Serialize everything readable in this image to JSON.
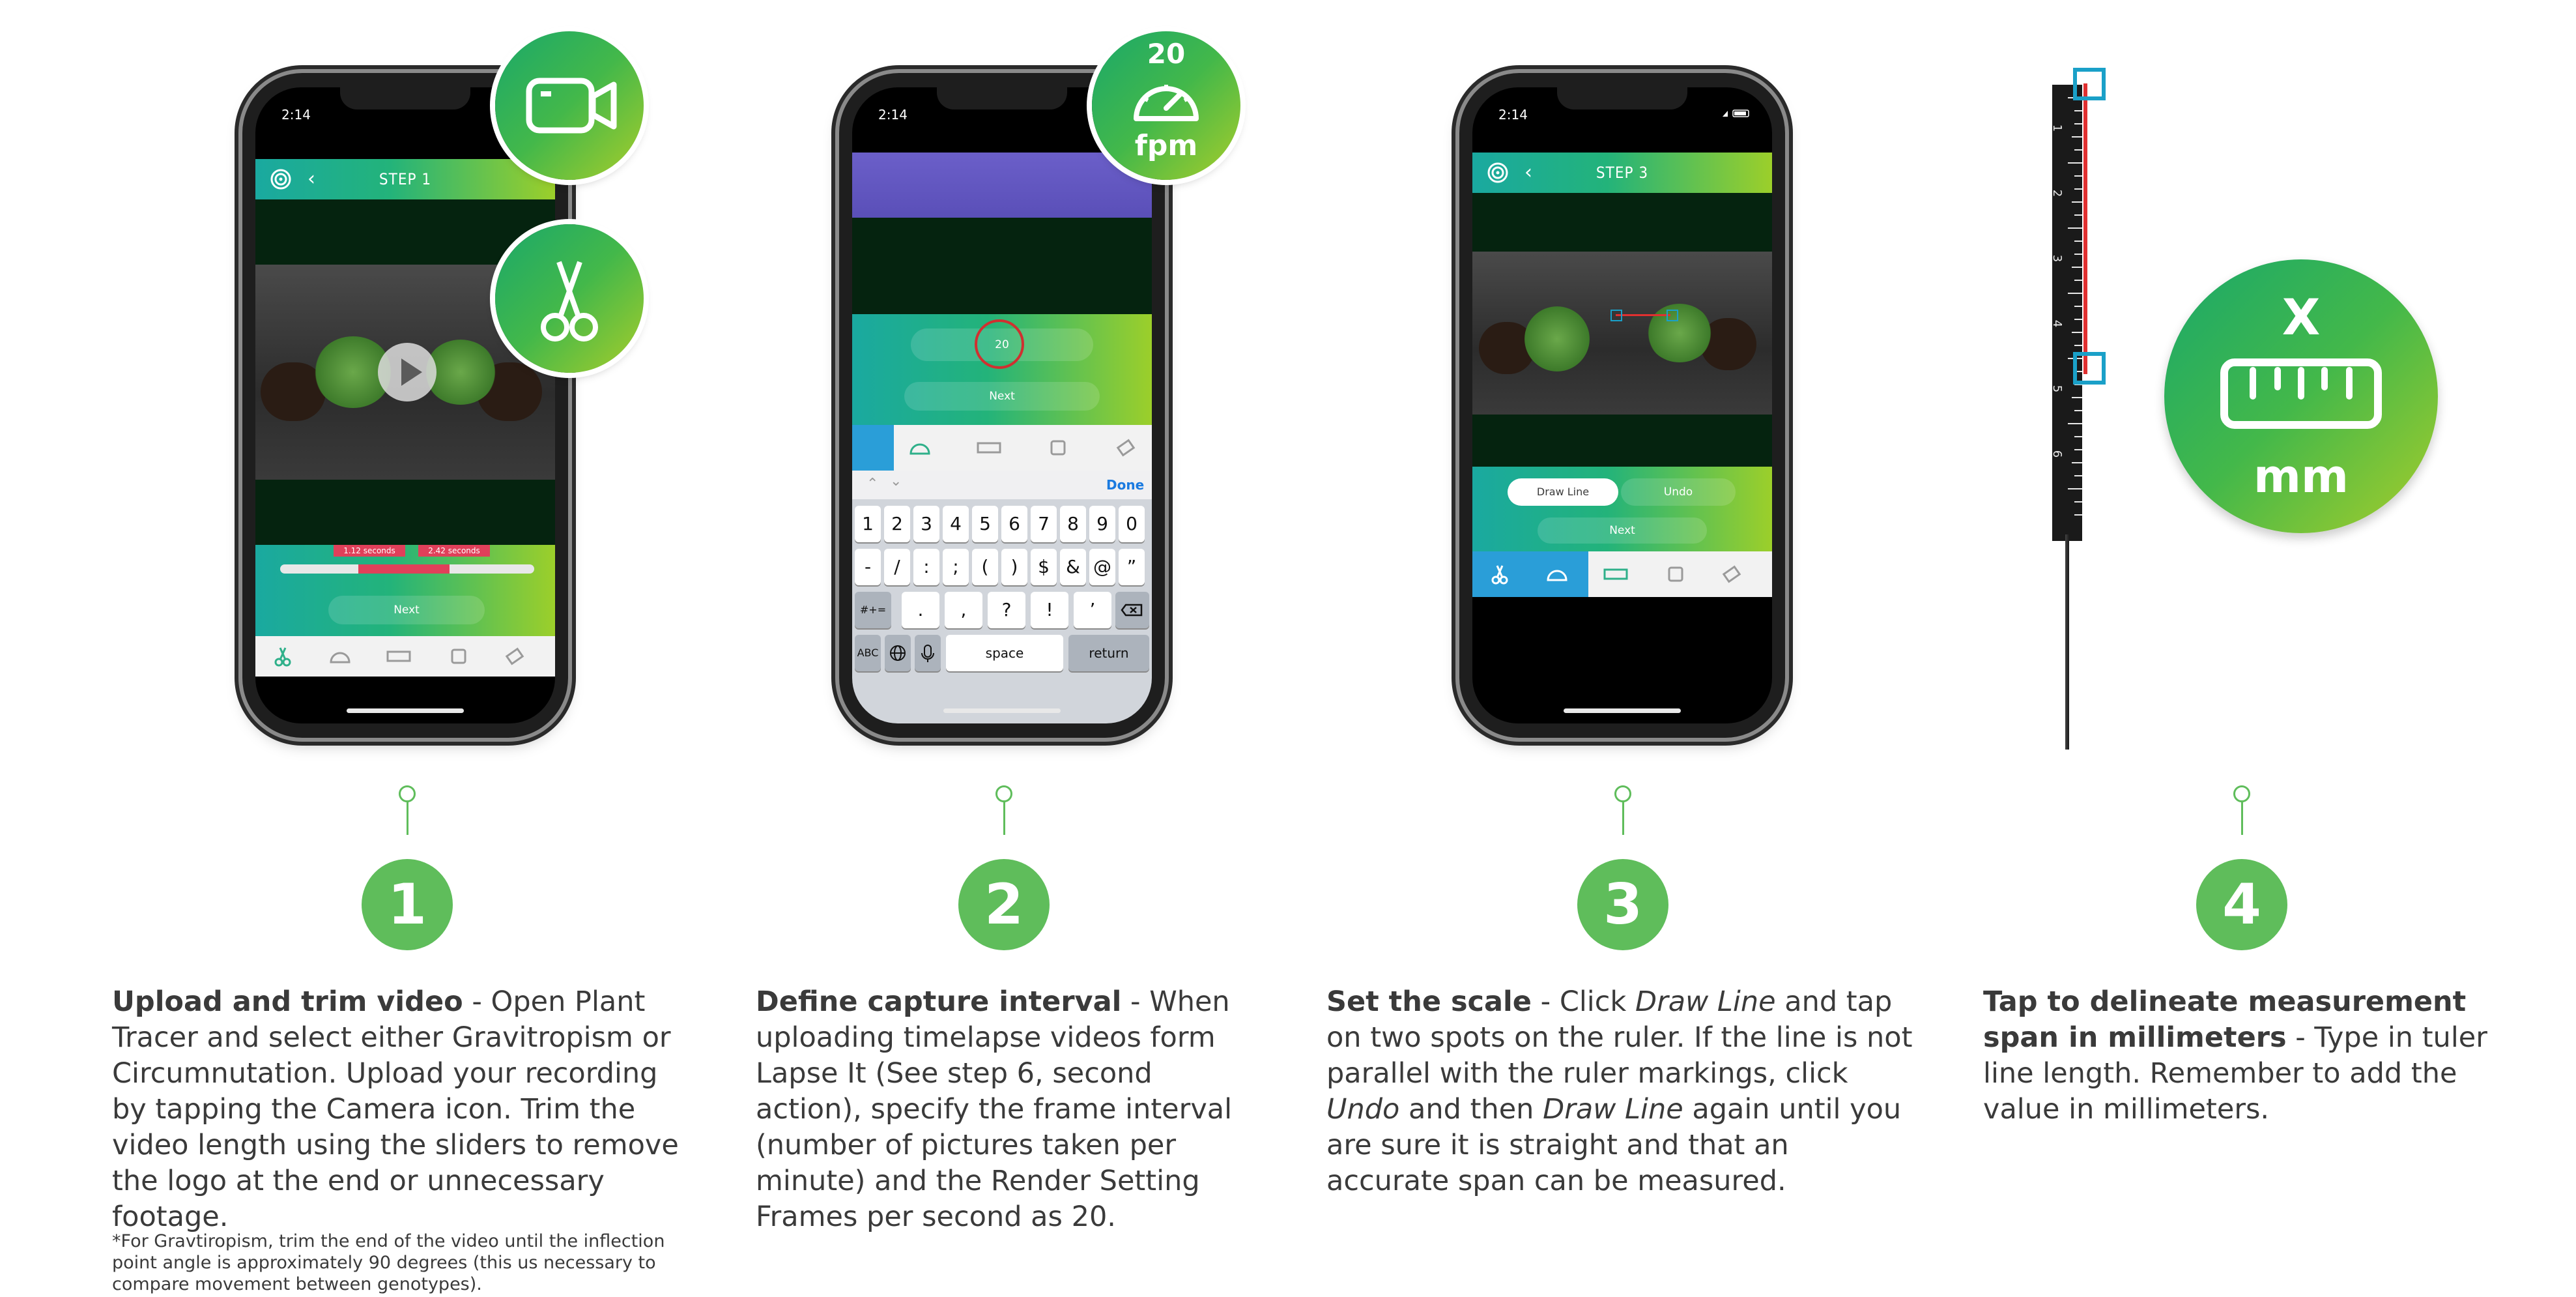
{
  "steps": [
    {
      "number": "1",
      "title": "Upload and trim video",
      "body": " - Open Plant Tracer and select either Gravitropism or Circumnutation. Upload your recording by tapping the Camera icon. Trim the video length using the sliders to remove the logo at the end or unnecessary footage.",
      "note": "*For Gravtiropism, trim the end of the video until the inflection point angle is approximately 90 degrees (this us necessary to compare movement between genotypes).",
      "phone": {
        "time": "2:14",
        "screen_title": "STEP 1",
        "trim_start": "1.12 seconds",
        "trim_end": "2.42 seconds",
        "next_label": "Next"
      },
      "bubble_icons": [
        "camera-icon",
        "scissors-icon"
      ]
    },
    {
      "number": "2",
      "title": "Define capture interval",
      "body_parts": [
        " - When uploading timelapse videos form Lapse It (See step 6, second action), specify the frame interval (number of pictures taken per minute) and the Render Setting Frames per second as 20."
      ],
      "phone": {
        "time": "2:14",
        "input_value": "20",
        "next_label": "Next",
        "done_label": "Done",
        "keys_row1": [
          "1",
          "2",
          "3",
          "4",
          "5",
          "6",
          "7",
          "8",
          "9",
          "0"
        ],
        "keys_row2": [
          "-",
          "/",
          ":",
          ";",
          "(",
          ")",
          "$",
          "&",
          "@",
          "”"
        ],
        "keys_row3": [
          ".",
          ",",
          "?",
          "!",
          "’"
        ],
        "key_shift": "#+=",
        "key_abc": "ABC",
        "key_space": "space",
        "key_return": "return"
      },
      "bubble": {
        "value": "20",
        "unit": "fpm"
      }
    },
    {
      "number": "3",
      "title": "Set the scale",
      "body_parts": [
        " - Click ",
        "Draw Line",
        " and tap on two spots on the ruler. If the line is not parallel with the ruler markings, click ",
        "Undo",
        " and then ",
        "Draw Line",
        " again until you are sure it is straight and that an accurate span can be measured."
      ],
      "phone": {
        "time": "2:14",
        "screen_title": "STEP 3",
        "draw_line_label": "Draw Line",
        "undo_label": "Undo",
        "next_label": "Next"
      }
    },
    {
      "number": "4",
      "title": "Tap to delineate measurement span in millimeters",
      "body": " - Type in tuler line length. Remember to add the value in millimeters.",
      "bubble": {
        "top": "X",
        "unit": "mm"
      },
      "ruler_labels": [
        "1",
        "2",
        "3",
        "4",
        "5",
        "6"
      ]
    }
  ],
  "colors": {
    "step_green": "#5fbd5b",
    "gradient_start": "#1aa9a0",
    "gradient_end": "#9ccf2a",
    "marker_blue": "#1aa0c8",
    "ruler_red": "#e03030"
  }
}
